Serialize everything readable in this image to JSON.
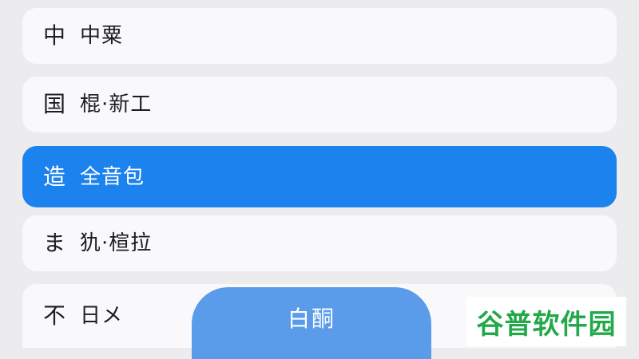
{
  "list": {
    "items": [
      {
        "mark": "中",
        "label": "中粟"
      },
      {
        "mark": "国",
        "label": "棍·新工"
      },
      {
        "mark": "造",
        "label": "全音包"
      },
      {
        "mark": "ま",
        "label": "犰·楦拉"
      },
      {
        "mark": "不",
        "label": "日メ"
      }
    ],
    "selected_index": 2
  },
  "bottom_button": {
    "label": "白酮"
  },
  "watermark": {
    "text": "谷普软件园"
  },
  "colors": {
    "background": "#ececee",
    "row": "#f9f9fb",
    "selected": "#1b82ee",
    "button": "#5a9bea",
    "watermark_text": "#23a84a"
  }
}
